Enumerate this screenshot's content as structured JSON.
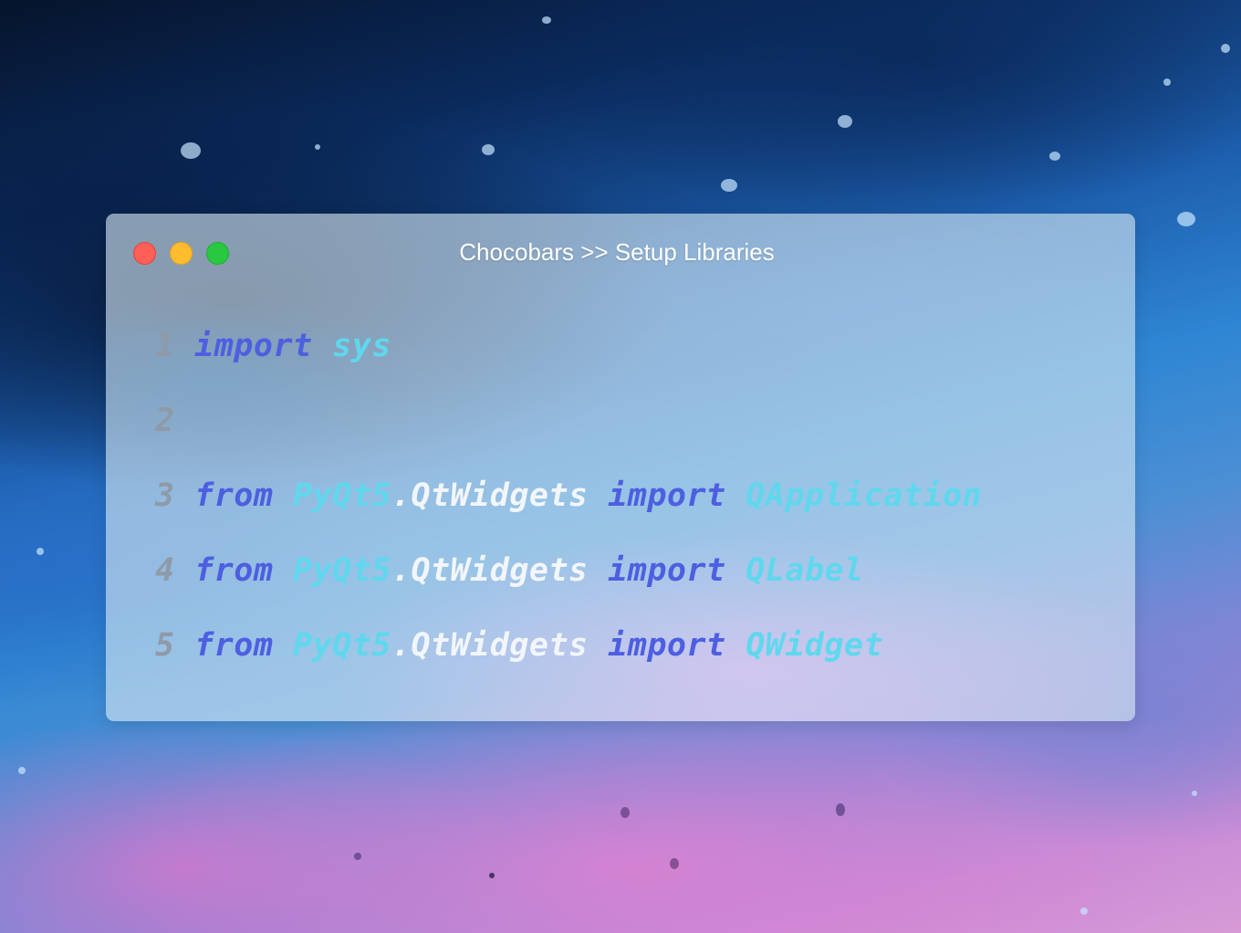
{
  "window": {
    "title": "Chocobars >> Setup Libraries",
    "buttons": {
      "close_color": "#fe5f57",
      "minimize_color": "#febc2e",
      "maximize_color": "#28c840"
    }
  },
  "code": {
    "lines": [
      {
        "number": "1",
        "tokens": [
          "import",
          "sys"
        ]
      },
      {
        "number": "2",
        "tokens": []
      },
      {
        "number": "3",
        "tokens": [
          "from",
          "PyQt5",
          ".QtWidgets",
          "import",
          "QApplication"
        ]
      },
      {
        "number": "4",
        "tokens": [
          "from",
          "PyQt5",
          ".QtWidgets",
          "import",
          "QLabel"
        ]
      },
      {
        "number": "5",
        "tokens": [
          "from",
          "PyQt5",
          ".QtWidgets",
          "import",
          "QWidget"
        ]
      }
    ],
    "colors": {
      "line_number": "#8f9aa8",
      "keyword": "#4d5fe0",
      "module": "#5fd8ee",
      "attribute": "#f2f6fb"
    }
  }
}
